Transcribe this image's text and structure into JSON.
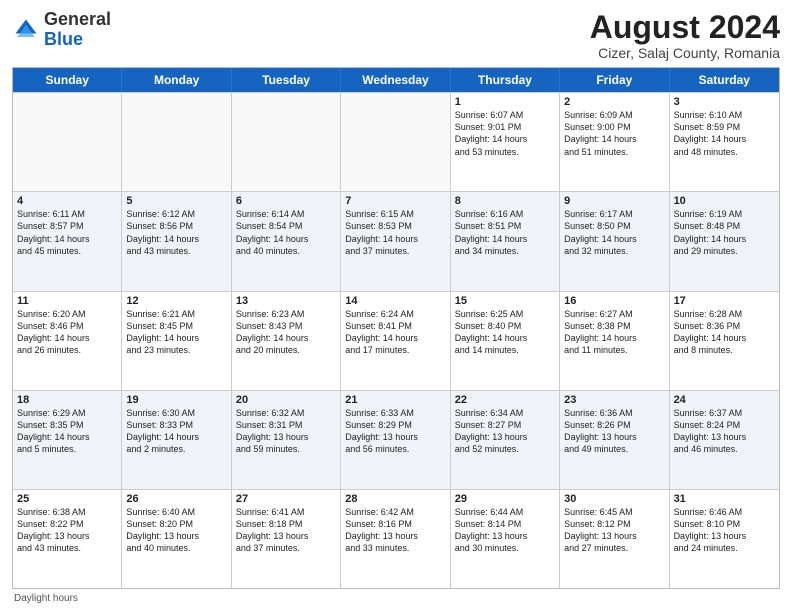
{
  "header": {
    "logo_general": "General",
    "logo_blue": "Blue",
    "month_year": "August 2024",
    "location": "Cizer, Salaj County, Romania"
  },
  "days_of_week": [
    "Sunday",
    "Monday",
    "Tuesday",
    "Wednesday",
    "Thursday",
    "Friday",
    "Saturday"
  ],
  "footer": {
    "daylight_label": "Daylight hours"
  },
  "weeks": [
    [
      {
        "day": "",
        "text": ""
      },
      {
        "day": "",
        "text": ""
      },
      {
        "day": "",
        "text": ""
      },
      {
        "day": "",
        "text": ""
      },
      {
        "day": "1",
        "text": "Sunrise: 6:07 AM\nSunset: 9:01 PM\nDaylight: 14 hours\nand 53 minutes."
      },
      {
        "day": "2",
        "text": "Sunrise: 6:09 AM\nSunset: 9:00 PM\nDaylight: 14 hours\nand 51 minutes."
      },
      {
        "day": "3",
        "text": "Sunrise: 6:10 AM\nSunset: 8:59 PM\nDaylight: 14 hours\nand 48 minutes."
      }
    ],
    [
      {
        "day": "4",
        "text": "Sunrise: 6:11 AM\nSunset: 8:57 PM\nDaylight: 14 hours\nand 45 minutes."
      },
      {
        "day": "5",
        "text": "Sunrise: 6:12 AM\nSunset: 8:56 PM\nDaylight: 14 hours\nand 43 minutes."
      },
      {
        "day": "6",
        "text": "Sunrise: 6:14 AM\nSunset: 8:54 PM\nDaylight: 14 hours\nand 40 minutes."
      },
      {
        "day": "7",
        "text": "Sunrise: 6:15 AM\nSunset: 8:53 PM\nDaylight: 14 hours\nand 37 minutes."
      },
      {
        "day": "8",
        "text": "Sunrise: 6:16 AM\nSunset: 8:51 PM\nDaylight: 14 hours\nand 34 minutes."
      },
      {
        "day": "9",
        "text": "Sunrise: 6:17 AM\nSunset: 8:50 PM\nDaylight: 14 hours\nand 32 minutes."
      },
      {
        "day": "10",
        "text": "Sunrise: 6:19 AM\nSunset: 8:48 PM\nDaylight: 14 hours\nand 29 minutes."
      }
    ],
    [
      {
        "day": "11",
        "text": "Sunrise: 6:20 AM\nSunset: 8:46 PM\nDaylight: 14 hours\nand 26 minutes."
      },
      {
        "day": "12",
        "text": "Sunrise: 6:21 AM\nSunset: 8:45 PM\nDaylight: 14 hours\nand 23 minutes."
      },
      {
        "day": "13",
        "text": "Sunrise: 6:23 AM\nSunset: 8:43 PM\nDaylight: 14 hours\nand 20 minutes."
      },
      {
        "day": "14",
        "text": "Sunrise: 6:24 AM\nSunset: 8:41 PM\nDaylight: 14 hours\nand 17 minutes."
      },
      {
        "day": "15",
        "text": "Sunrise: 6:25 AM\nSunset: 8:40 PM\nDaylight: 14 hours\nand 14 minutes."
      },
      {
        "day": "16",
        "text": "Sunrise: 6:27 AM\nSunset: 8:38 PM\nDaylight: 14 hours\nand 11 minutes."
      },
      {
        "day": "17",
        "text": "Sunrise: 6:28 AM\nSunset: 8:36 PM\nDaylight: 14 hours\nand 8 minutes."
      }
    ],
    [
      {
        "day": "18",
        "text": "Sunrise: 6:29 AM\nSunset: 8:35 PM\nDaylight: 14 hours\nand 5 minutes."
      },
      {
        "day": "19",
        "text": "Sunrise: 6:30 AM\nSunset: 8:33 PM\nDaylight: 14 hours\nand 2 minutes."
      },
      {
        "day": "20",
        "text": "Sunrise: 6:32 AM\nSunset: 8:31 PM\nDaylight: 13 hours\nand 59 minutes."
      },
      {
        "day": "21",
        "text": "Sunrise: 6:33 AM\nSunset: 8:29 PM\nDaylight: 13 hours\nand 56 minutes."
      },
      {
        "day": "22",
        "text": "Sunrise: 6:34 AM\nSunset: 8:27 PM\nDaylight: 13 hours\nand 52 minutes."
      },
      {
        "day": "23",
        "text": "Sunrise: 6:36 AM\nSunset: 8:26 PM\nDaylight: 13 hours\nand 49 minutes."
      },
      {
        "day": "24",
        "text": "Sunrise: 6:37 AM\nSunset: 8:24 PM\nDaylight: 13 hours\nand 46 minutes."
      }
    ],
    [
      {
        "day": "25",
        "text": "Sunrise: 6:38 AM\nSunset: 8:22 PM\nDaylight: 13 hours\nand 43 minutes."
      },
      {
        "day": "26",
        "text": "Sunrise: 6:40 AM\nSunset: 8:20 PM\nDaylight: 13 hours\nand 40 minutes."
      },
      {
        "day": "27",
        "text": "Sunrise: 6:41 AM\nSunset: 8:18 PM\nDaylight: 13 hours\nand 37 minutes."
      },
      {
        "day": "28",
        "text": "Sunrise: 6:42 AM\nSunset: 8:16 PM\nDaylight: 13 hours\nand 33 minutes."
      },
      {
        "day": "29",
        "text": "Sunrise: 6:44 AM\nSunset: 8:14 PM\nDaylight: 13 hours\nand 30 minutes."
      },
      {
        "day": "30",
        "text": "Sunrise: 6:45 AM\nSunset: 8:12 PM\nDaylight: 13 hours\nand 27 minutes."
      },
      {
        "day": "31",
        "text": "Sunrise: 6:46 AM\nSunset: 8:10 PM\nDaylight: 13 hours\nand 24 minutes."
      }
    ]
  ]
}
